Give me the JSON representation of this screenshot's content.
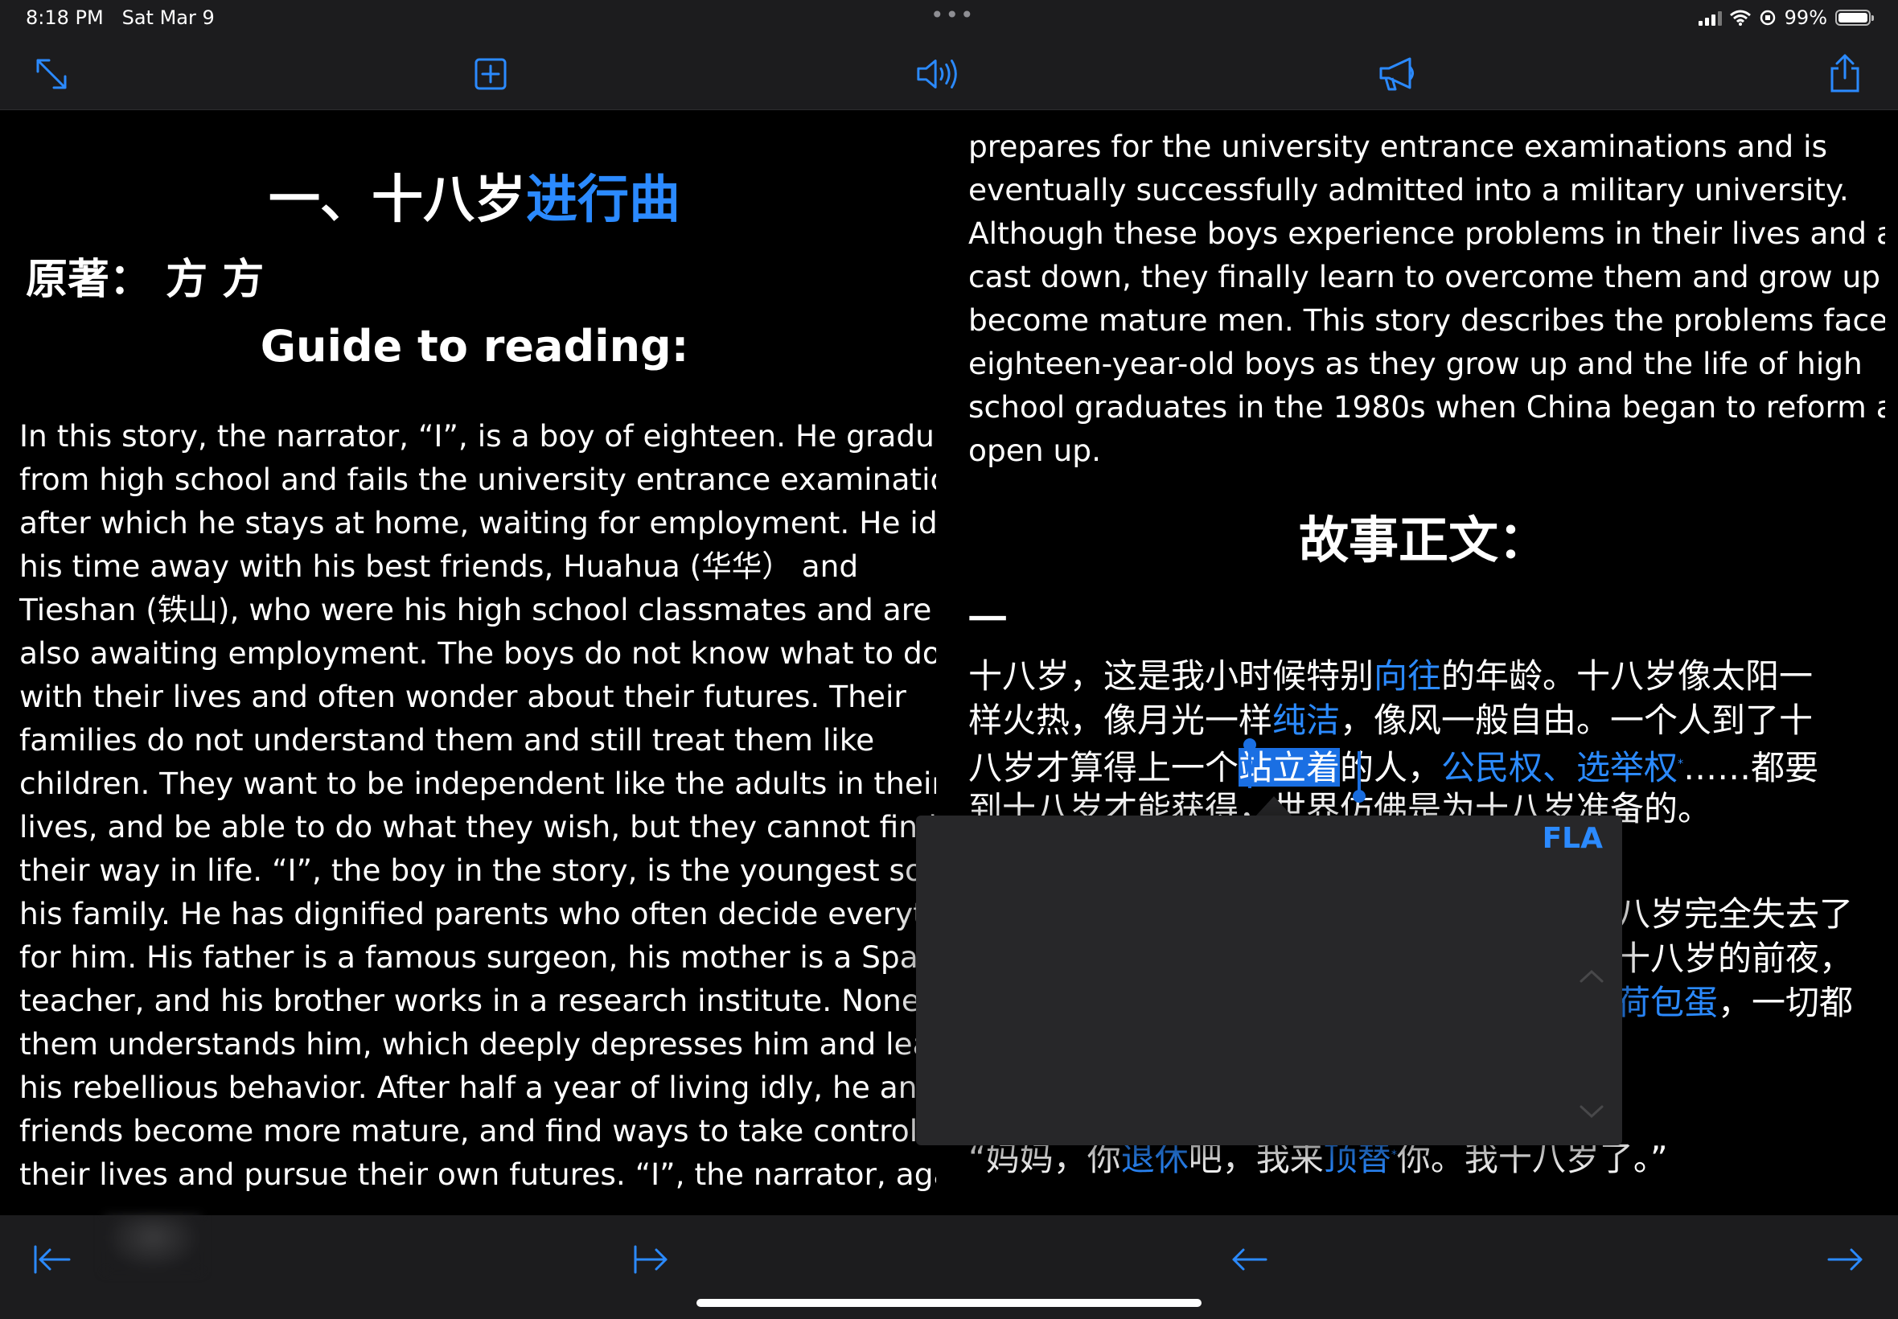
{
  "status": {
    "time": "8:18 PM",
    "date": "Sat Mar 9",
    "battery_percent": 99,
    "battery_label": "99%"
  },
  "toolbar": {
    "icons": [
      "expand-icon",
      "add-note-icon",
      "speaker-icon",
      "megaphone-icon",
      "share-icon"
    ]
  },
  "left_page": {
    "title_black": "一、十八岁",
    "title_blue": "进行曲",
    "author": "原著： 方 方",
    "guide_heading": "Guide to reading:",
    "guide_lines": [
      "In this story, the narrator, “I”, is a boy of eighteen. He graduates",
      "from high school and fails the university entrance examination,",
      "after which he stays at home, waiting for employment. He idles",
      "his time away with his best friends, Huahua (华华）  and",
      "Tieshan (铁山), who were his high school classmates and are",
      "also awaiting employment. The boys do not know what to do",
      "with their lives and often wonder about their futures. Their",
      "families do not understand them and still treat them like",
      "children. They want to be independent like the adults in their",
      "lives, and be able to do what they wish, but they cannot find",
      "their way in life. “I”, the boy in the story, is the youngest son in",
      "his family. He has dignified parents who often decide everything",
      "for him. His father is a famous surgeon, his mother is a Spanish",
      "teacher, and his brother works in a research institute. None of",
      "them understands him, which deeply depresses him and leads to",
      "his rebellious behavior. After half a year of living idly, he and his",
      "friends become more mature, and find ways to take control of",
      "their lives and pursue their own futures. “I”, the narrator, again"
    ]
  },
  "right_page": {
    "guide_lines": [
      "prepares for the university entrance examinations and is",
      "eventually successfully admitted into a military university.",
      "Although these boys experience problems in their lives and are",
      "cast down, they finally learn to overcome them and grow up to",
      "become mature men. This story describes the problems faced by",
      "eighteen-year-old boys as they grow up and the life of high",
      "school graduates in the 1980s when China began to reform and",
      "open up."
    ],
    "story_heading": "故事正文：",
    "chapter": "一",
    "cn": {
      "l1a": "十八岁，这是我小时候特别",
      "l1b": "向往",
      "l1c": "的年龄。十八岁像太阳一",
      "l2a": "样火热，像月光一样",
      "l2b": "纯洁",
      "l2c": "，像风一般自由。一个人到了十",
      "l3a": "八岁才算得上一个",
      "l3sel": "站立着",
      "l3b": "的人，",
      "l3c": "公民权、选举权",
      "l3sup": "*",
      "l3d": "……都要",
      "l4": "到十八岁才能获得，世界仿佛是为十八岁准备的。",
      "m1": "八岁完全失去了",
      "m2": "十八岁的前夜，",
      "m3a": "荷包蛋",
      "m3b": "，一切都",
      "last_a": "“妈妈，你",
      "last_b": "退休",
      "last_c": "吧，我来",
      "last_d": "顶替",
      "last_sup": "*",
      "last_e": "你。我十八岁了。”"
    }
  },
  "popover": {
    "lang": "FLA"
  },
  "bottom": {
    "icons": [
      "first-page-icon",
      "last-page-icon",
      "previous-page-icon",
      "next-page-icon"
    ]
  }
}
